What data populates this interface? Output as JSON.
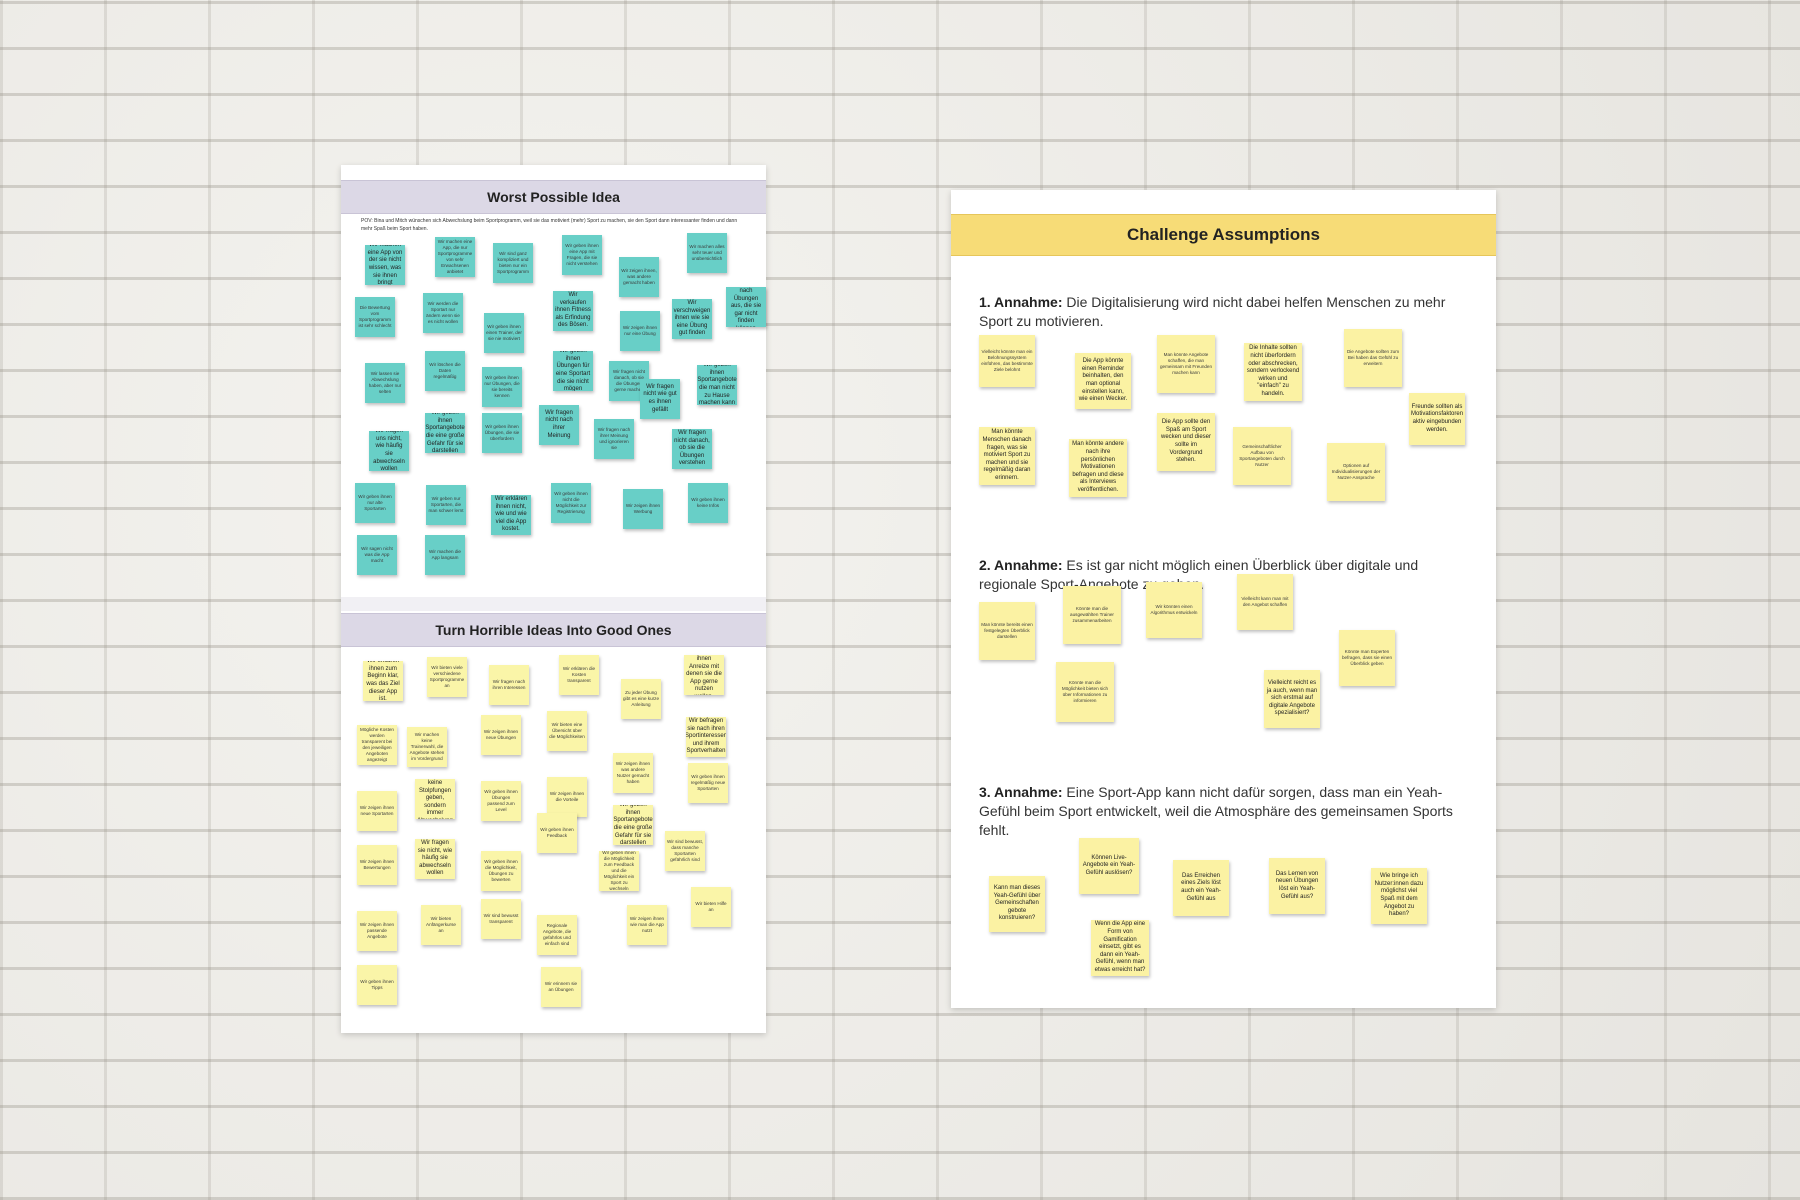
{
  "left_poster": {
    "worst_title": "Worst Possible Idea",
    "pov": "POV: Bina und Mitch wünschen sich Abwechslung beim Sportprogramm, weil sie das motiviert (mehr) Sport zu machen, sie den Sport dann interessanter finden und dann mehr Spaß beim Sport haben.",
    "worst_notes": [
      {
        "text": "Wir machen eine App von der sie nicht wissen, was sie ihnen bringt",
        "big": true
      },
      {
        "text": "Wir machen eine App, die nur Sportprogramme von sehr Erwachsenen anbietet",
        "big": false
      },
      {
        "text": "Wir sind ganz kompliziert und bieten nur ein Sportprogramm",
        "big": false
      },
      {
        "text": "Wir geben ihnen eine App mit Fragen, die sie nicht verstehen",
        "big": false
      },
      {
        "text": "Wir zeigen ihnen, was andere gemacht haben",
        "big": false
      },
      {
        "text": "Wir machen alles sehr teuer und unübersichtlich",
        "big": false
      },
      {
        "text": "Die Bewertung vom Sportprogramm ist sehr schlecht",
        "big": false
      },
      {
        "text": "Wir werden die Sportart nur ändern wenn sie es nicht wollen",
        "big": false
      },
      {
        "text": "Wir geben ihnen einen Trainer, der sie nie motiviert",
        "big": false
      },
      {
        "text": "Wir verkaufen ihnen Fitness als Erfindung des Bösen.",
        "big": true
      },
      {
        "text": "Wir zeigen ihnen nur eine Übung",
        "big": false
      },
      {
        "text": "Wir verschweigen ihnen wie sie eine Übung gut finden",
        "big": true
      },
      {
        "text": "Wir suchen nach Übungen aus, die sie gar nicht finden können",
        "big": true
      },
      {
        "text": "Wir lassen sie Abwechslung haben, aber nur selten",
        "big": false
      },
      {
        "text": "Wir löschen die Daten regelmäßig",
        "big": false
      },
      {
        "text": "Wir geben ihnen nur Übungen, die sie bereits kennen",
        "big": false
      },
      {
        "text": "Wir geben ihnen Übungen für eine Sportart die sie nicht mögen",
        "big": true
      },
      {
        "text": "Wir fragen nicht danach, ob sie die Übungen gerne machen",
        "big": false
      },
      {
        "text": "Wir fragen nicht wie gut es ihnen gefällt",
        "big": true
      },
      {
        "text": "Wir geben ihnen Sportangebote die man nicht zu Hause machen kann",
        "big": true
      },
      {
        "text": "Wir fragen uns nicht, wie häufig sie abwechseln wollen",
        "big": true
      },
      {
        "text": "Wir geben ihnen Sportangebote die eine große Gefahr für sie darstellen",
        "big": true
      },
      {
        "text": "Wir geben ihnen Übungen, die sie überfordern",
        "big": false
      },
      {
        "text": "Wir fragen nicht nach ihrer Meinung",
        "big": true
      },
      {
        "text": "Wir fragen nach ihrer Meinung und ignorieren sie",
        "big": false
      },
      {
        "text": "Wir fragen nicht danach, ob sie die Übungen verstehen",
        "big": true
      },
      {
        "text": "Wir geben ihnen nur alte Sportarten",
        "big": false
      },
      {
        "text": "Wir geben nur Sportarten, die man schwer lernt",
        "big": false
      },
      {
        "text": "Wir erklären ihnen nicht, wie und wie viel die App kostet.",
        "big": true
      },
      {
        "text": "Wir geben ihnen nicht die Möglichkeit zur Registrierung",
        "big": false
      },
      {
        "text": "Wir zeigen ihnen Werbung",
        "big": false
      },
      {
        "text": "Wir geben ihnen keine Infos",
        "big": false
      },
      {
        "text": "Wir sagen nicht was die App macht",
        "big": false
      },
      {
        "text": "Wir machen die App langsam",
        "big": false
      }
    ],
    "good_title": "Turn Horrible Ideas Into Good Ones",
    "good_notes": [
      {
        "text": "Wir erklären ihnen zum Beginn klar, was das Ziel dieser App ist.",
        "big": true
      },
      {
        "text": "Wir bieten viele verschiedene Sportprogramme an",
        "big": false
      },
      {
        "text": "Wir fragen nach ihren Interessen",
        "big": false
      },
      {
        "text": "Wir erklären die Kosten transparent",
        "big": false
      },
      {
        "text": "Zu jeder Übung gibt es eine kurze Anleitung",
        "big": false
      },
      {
        "text": "Wir geben ihnen Anreize mit denen sie die App gerne nutzen wollen.",
        "big": true
      },
      {
        "text": "Wir befragen sie nach ihren Sportinteressen und ihrem Sportverhalten",
        "big": true
      },
      {
        "text": "Mögliche Kosten werden transparent bei den jeweiligen Angeboten angezeigt",
        "big": false
      },
      {
        "text": "Wir machen keine Trainerwahl, die Angebote stehen im Vordergrund",
        "big": false
      },
      {
        "text": "Wir zeigen ihnen neue Übungen",
        "big": false
      },
      {
        "text": "Wir bieten eine Übersicht über die Möglichkeiten",
        "big": false
      },
      {
        "text": "Wir zeigen ihnen was andere Nutzer gemacht haben",
        "big": false
      },
      {
        "text": "Wir geben ihnen regelmäßig neue Sportarten",
        "big": false
      },
      {
        "text": "Wir zeigen ihnen neue Sportarten",
        "big": false
      },
      {
        "text": "Es sollte keine Stolpfungen geben, sondern immer Abwechslung",
        "big": true
      },
      {
        "text": "Wir geben ihnen Übungen passend zum Level",
        "big": false
      },
      {
        "text": "Wir zeigen ihnen die Vorteile",
        "big": false
      },
      {
        "text": "Wir geben ihnen Sportangebote die eine große Gefahr für sie darstellen",
        "big": true
      },
      {
        "text": "Wir zeigen ihnen Bewertungen",
        "big": false
      },
      {
        "text": "Wir fragen sie nicht, wie häufig sie abwechseln wollen",
        "big": true
      },
      {
        "text": "Wir geben ihnen die Möglichkeit, Übungen zu bewerten",
        "big": false
      },
      {
        "text": "Wir geben ihnen Feedback",
        "big": false
      },
      {
        "text": "Wir geben ihnen die Möglichkeit zum Feedback und die Möglichkeit ein Sport zu wechseln",
        "big": false
      },
      {
        "text": "Wir sind bewusst, dass manche Sportarten gefährlich sind",
        "big": false
      },
      {
        "text": "Wir zeigen ihnen passende Angebote",
        "big": false
      },
      {
        "text": "Wir bieten Anfängerkurse an",
        "big": false
      },
      {
        "text": "Wir sind bewusst transparent",
        "big": false
      },
      {
        "text": "Regionale Angebote, die gefahrlos und einfach sind",
        "big": false
      },
      {
        "text": "Wir zeigen ihnen wie man die App nutzt",
        "big": false
      },
      {
        "text": "Wir bieten Hilfe an",
        "big": false
      },
      {
        "text": "Wir geben ihnen Tipps",
        "big": false
      },
      {
        "text": "Wir erinnern sie an Übungen",
        "big": false
      }
    ]
  },
  "right_poster": {
    "title": "Challenge Assumptions",
    "assumptions": [
      {
        "label": "1. Annahme:",
        "text": " Die Digitalisierung wird nicht dabei helfen Menschen zu mehr Sport zu motivieren."
      },
      {
        "label": "2. Annahme:",
        "text": " Es ist gar nicht möglich einen Überblick über digitale und regionale Sport-Angebote zu geben."
      },
      {
        "label": "3. Annahme:",
        "text": " Eine Sport-App kann nicht dafür sorgen, dass man ein Yeah-Gefühl beim Sport entwickelt, weil die Atmosphäre des gemeinsamen Sports fehlt."
      }
    ],
    "notes_a1": [
      {
        "text": "Vielleicht könnte man ein Belohnungssystem einführen, das bestimmte Ziele belohnt",
        "big": false
      },
      {
        "text": "Die App könnte einen Reminder beinhalten, den man optional einstellen kann, wie einen Wecker.",
        "big": true
      },
      {
        "text": "Man könnte Angebote schaffen, die man gemeinsam mit Freunden machen kann",
        "big": false
      },
      {
        "text": "Die Inhalte sollten nicht überfordern oder abschrecken, sondern verlockend wirken und \"einfach\" zu handeln.",
        "big": true
      },
      {
        "text": "Die Angebote sollten zum Bei haben das Gefühl zu erweitern",
        "big": false
      },
      {
        "text": "Freunde sollten als Motivationsfaktoren aktiv eingebunden werden.",
        "big": true
      },
      {
        "text": "Man könnte Menschen danach fragen, was sie motiviert Sport zu machen und sie regelmäßig daran erinnern.",
        "big": true
      },
      {
        "text": "Man könnte andere nach ihre persönlichen Motivationen befragen und diese als Interviews veröffentlichen.",
        "big": true
      },
      {
        "text": "Die App sollte den Spaß am Sport wecken und dieser sollte im Vordergrund stehen.",
        "big": true
      },
      {
        "text": "Gemeinschaftlicher Aufbau von Sportangeboten durch Nutzer",
        "big": false
      },
      {
        "text": "Optionen auf Individualisierungen der Nutzer-Ansprache",
        "big": false
      }
    ],
    "notes_a2": [
      {
        "text": "Man könnte bereits einen festgelegten Überblick darstellen",
        "big": false
      },
      {
        "text": "Könnte man die ausgewählten Trainer zusammenarbeiten",
        "big": false
      },
      {
        "text": "Wir könnten einen Algorithmus entwickeln",
        "big": false
      },
      {
        "text": "Vielleicht kann man mit den Angebot schaffen",
        "big": false
      },
      {
        "text": "Könnte man Experten befragen, dass sie einen Überblick geben",
        "big": false
      },
      {
        "text": "Könnte man die Möglichkeit bieten sich über Informationen zu informieren",
        "big": false
      },
      {
        "text": "Vielleicht reicht es ja auch, wenn man sich erstmal auf digitale Angebote spezialisiert?",
        "big": true
      }
    ],
    "notes_a3": [
      {
        "text": "Kann man dieses Yeah-Gefühl über Gemeinschaften gebote konstruieren?",
        "big": true
      },
      {
        "text": "Können Live-Angebote ein Yeah-Gefühl auslösen?",
        "big": true
      },
      {
        "text": "Das Erreichen eines Ziels löst auch ein Yeah-Gefühl aus",
        "big": true
      },
      {
        "text": "Das Lernen von neuen Übungen löst ein Yeah-Gefühl aus?",
        "big": true
      },
      {
        "text": "Wie bringe ich Nutzer:innen dazu möglichst viel Spaß mit dem Angebot zu haben?",
        "big": true
      },
      {
        "text": "Wenn die App eine Form von Gamification einsetzt, gibt es dann ein Yeah-Gefühl, wenn man etwas erreicht hat?",
        "big": true
      }
    ]
  }
}
